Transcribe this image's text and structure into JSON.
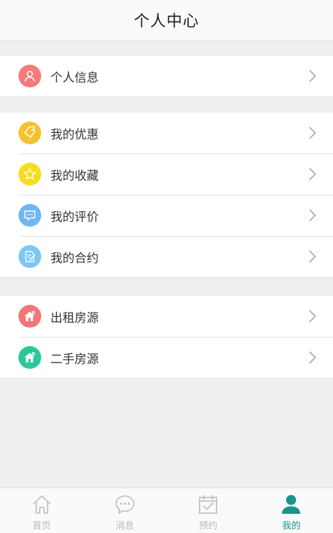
{
  "header": {
    "title": "个人中心"
  },
  "groups": {
    "profile": [
      {
        "label": "个人信息",
        "icon": "user-icon",
        "color": "#f37b7b"
      }
    ],
    "mine": [
      {
        "label": "我的优惠",
        "icon": "tag-icon",
        "color": "#f6c12f"
      },
      {
        "label": "我的收藏",
        "icon": "star-icon",
        "color": "#f7dd1e"
      },
      {
        "label": "我的评价",
        "icon": "comment-icon",
        "color": "#6fb6f2"
      },
      {
        "label": "我的合约",
        "icon": "contract-icon",
        "color": "#7cc8f2"
      }
    ],
    "houses": [
      {
        "label": "出租房源",
        "icon": "house-rent-icon",
        "color": "#f27676"
      },
      {
        "label": "二手房源",
        "icon": "house-secondhand-icon",
        "color": "#2bc79b"
      }
    ]
  },
  "tabbar": {
    "items": [
      {
        "label": "首页",
        "icon": "home-icon",
        "active": false
      },
      {
        "label": "消息",
        "icon": "message-icon",
        "active": false
      },
      {
        "label": "预约",
        "icon": "calendar-check-icon",
        "active": false
      },
      {
        "label": "我的",
        "icon": "person-icon",
        "active": true
      }
    ],
    "active_color": "#16958a",
    "inactive_color": "#b8b8b8"
  }
}
